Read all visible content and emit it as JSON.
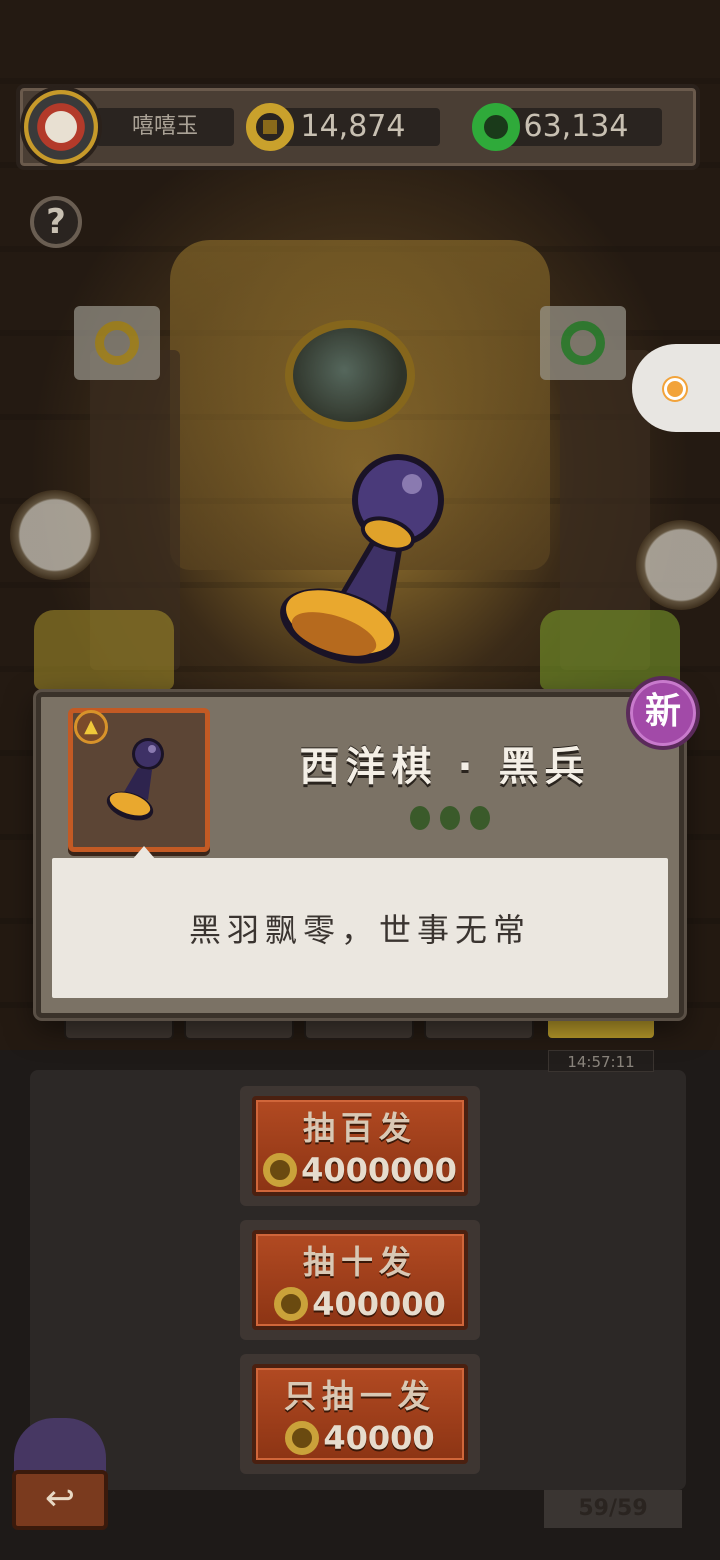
{
  "header": {
    "player_name": "嘻嘻玉",
    "coins": "14,874",
    "jade": "63,134"
  },
  "help_label": "?",
  "item_dialog": {
    "title": "西洋棋 · 黑兵",
    "new_badge": "新",
    "description": "黑羽飘零，世事无常",
    "rarity_icon": "triangle-icon"
  },
  "gacha": {
    "timer": "14:57:11",
    "buttons": [
      {
        "label": "抽百发",
        "price": "4000000"
      },
      {
        "label": "抽十发",
        "price": "400000"
      },
      {
        "label": "只抽一发",
        "price": "40000"
      }
    ],
    "counter": "59/59"
  },
  "colors": {
    "coin": "#c9a12c",
    "jade": "#2faa3a",
    "draw_button": "#b24a22",
    "new_badge": "#a24aa8"
  }
}
